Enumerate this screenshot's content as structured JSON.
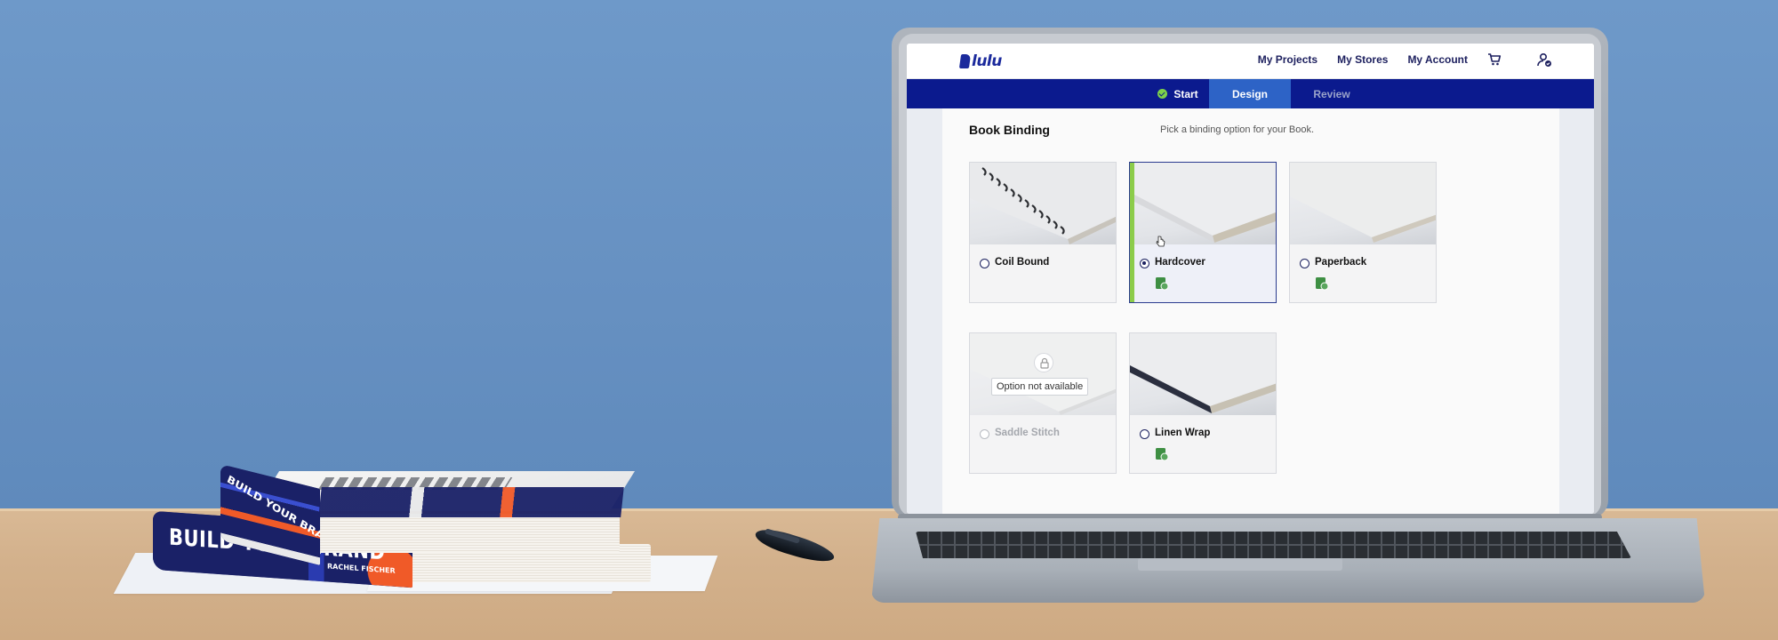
{
  "app": {
    "logo_text": "lulu",
    "nav": {
      "projects": "My Projects",
      "stores": "My Stores",
      "account": "My Account",
      "cart_icon": "cart-icon",
      "profile_icon": "user-profile-icon"
    },
    "steps": {
      "start": "Start",
      "design": "Design",
      "review": "Review"
    },
    "binding": {
      "title": "Book Binding",
      "hint": "Pick a binding option for your Book.",
      "options": [
        {
          "label": "Coil Bound",
          "selected": false,
          "available": true,
          "eco": false
        },
        {
          "label": "Hardcover",
          "selected": true,
          "available": true,
          "eco": true
        },
        {
          "label": "Paperback",
          "selected": false,
          "available": true,
          "eco": true
        },
        {
          "label": "Saddle Stitch",
          "selected": false,
          "available": false,
          "eco": false,
          "tooltip": "Option not available"
        },
        {
          "label": "Linen Wrap",
          "selected": false,
          "available": true,
          "eco": true
        }
      ]
    }
  },
  "scene": {
    "book_spine_title": "BUILD YOUR BRAND",
    "book_spine_author": "RACHEL FISCHER"
  },
  "colors": {
    "brand_navy": "#0b1a8e",
    "active_step": "#2d63c6",
    "selected_accent": "#8ccc4a",
    "eco_green": "#3e8f43"
  }
}
